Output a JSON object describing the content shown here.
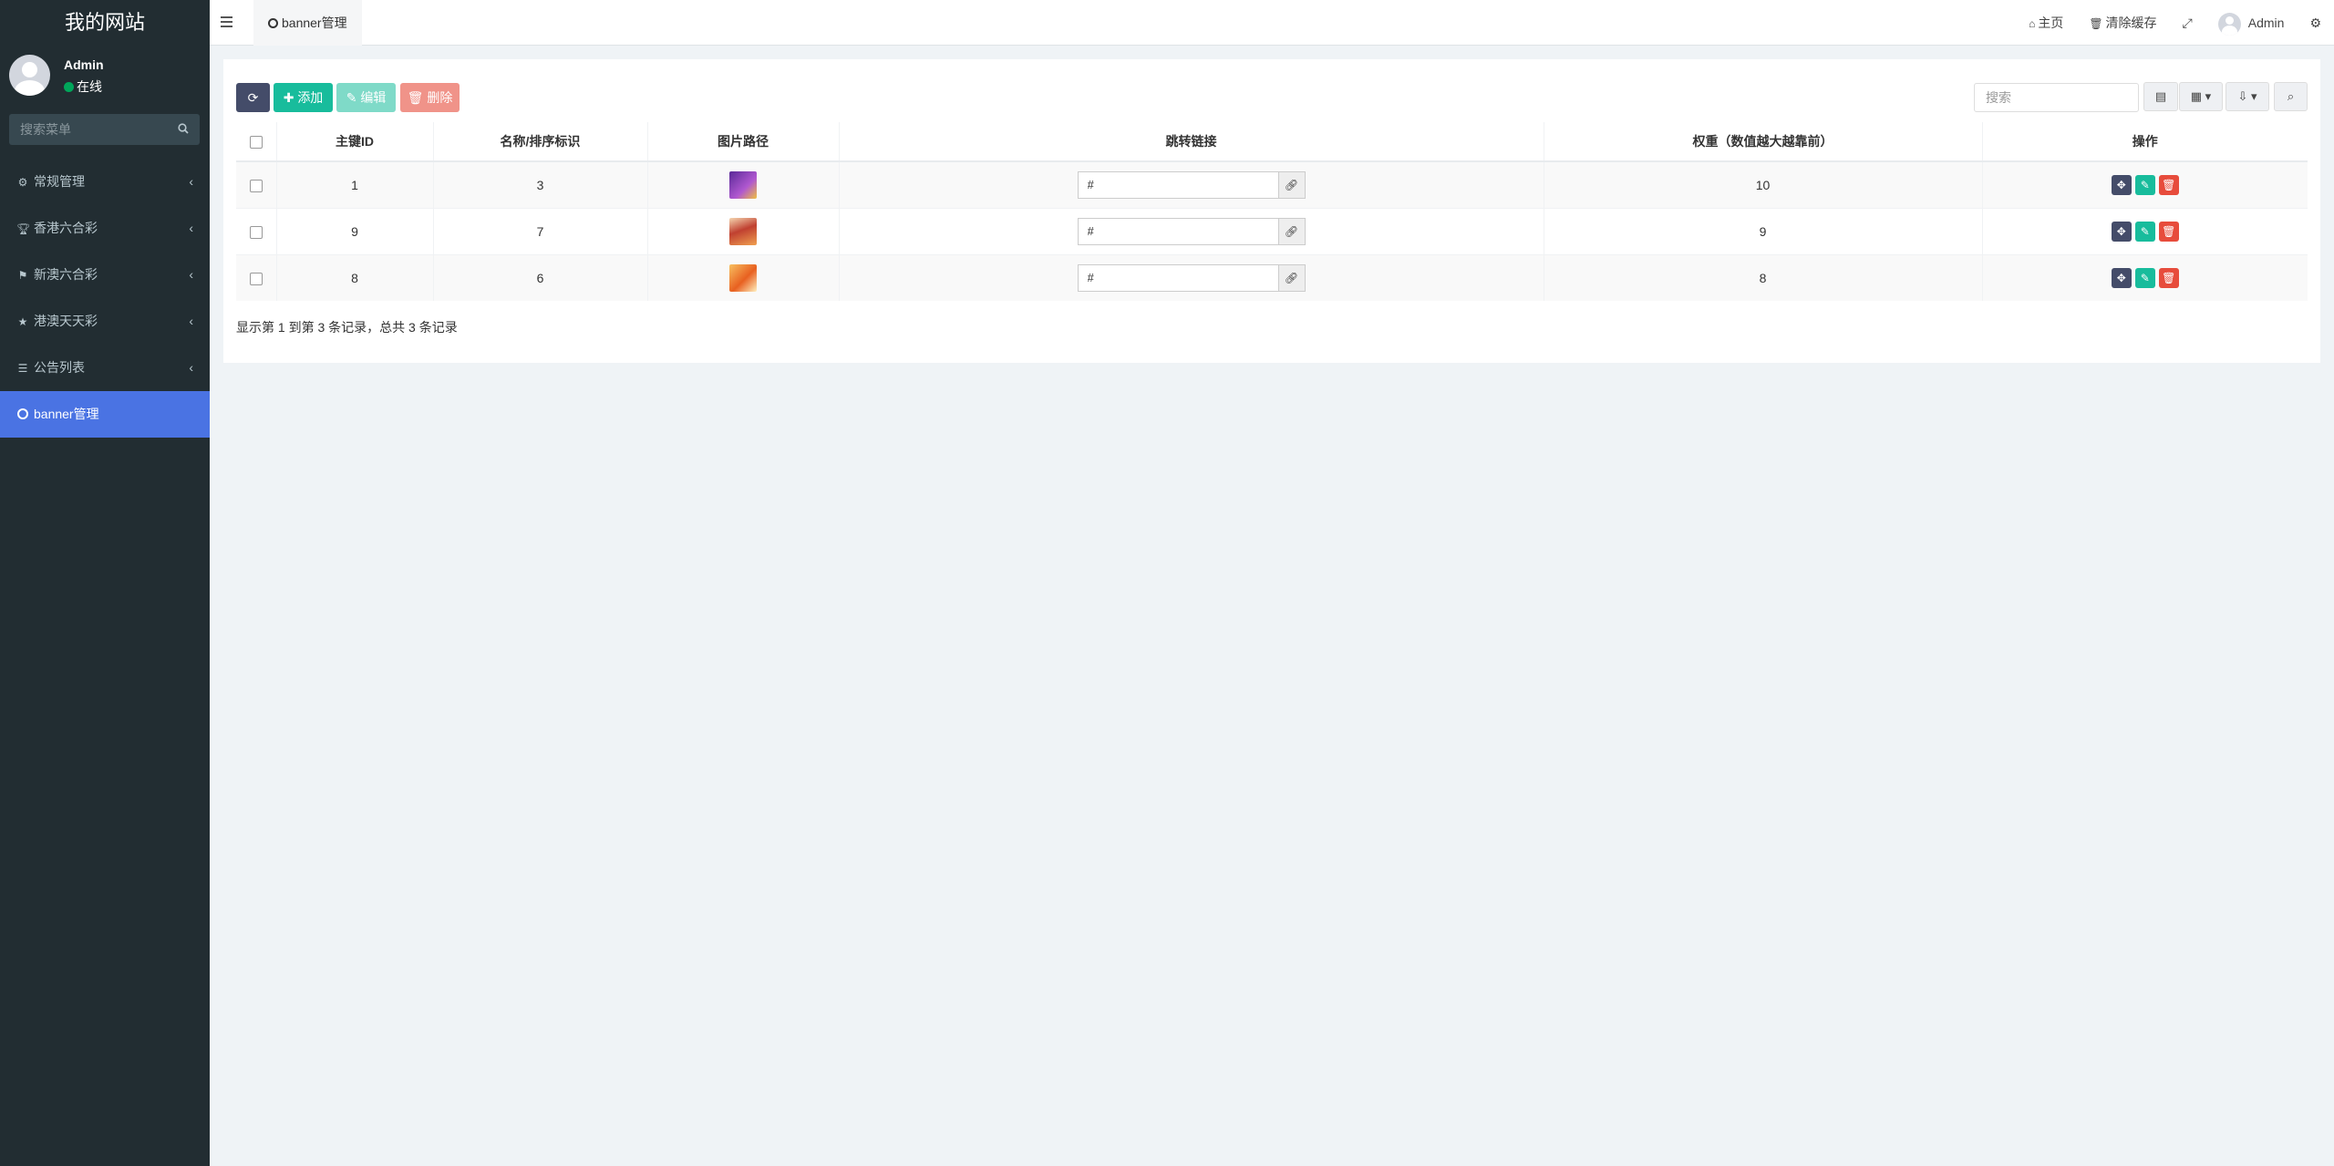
{
  "sidebar": {
    "brand": "我的网站",
    "user_name": "Admin",
    "user_status": "在线",
    "search_placeholder": "搜索菜单",
    "menu": [
      {
        "label": "常规管理",
        "icon": "cogs-icon"
      },
      {
        "label": "香港六合彩",
        "icon": "trophy-icon"
      },
      {
        "label": "新澳六合彩",
        "icon": "flag-icon"
      },
      {
        "label": "港澳天天彩",
        "icon": "star-icon"
      },
      {
        "label": "公告列表",
        "icon": "list-icon"
      },
      {
        "label": "banner管理",
        "icon": "circle-icon",
        "active": true
      }
    ]
  },
  "topbar": {
    "tab_label": "banner管理",
    "home": "主页",
    "clear_cache": "清除缓存",
    "user": "Admin"
  },
  "toolbar": {
    "refresh_icon": "refresh-icon",
    "add": "添加",
    "edit": "编辑",
    "delete": "删除",
    "search_placeholder": "搜索"
  },
  "table": {
    "headers": [
      "主键ID",
      "名称/排序标识",
      "图片路径",
      "跳转链接",
      "权重（数值越大越靠前）",
      "操作"
    ],
    "rows": [
      {
        "id": "1",
        "name": "3",
        "thumb_color": "#7a3fb0",
        "link": "#",
        "weight": "10"
      },
      {
        "id": "9",
        "name": "7",
        "thumb_color": "#e8a060",
        "link": "#",
        "weight": "9"
      },
      {
        "id": "8",
        "name": "6",
        "thumb_color": "#f08a30",
        "link": "#",
        "weight": "8"
      }
    ]
  },
  "footer": "显示第 1 到第 3 条记录，总共 3 条记录"
}
